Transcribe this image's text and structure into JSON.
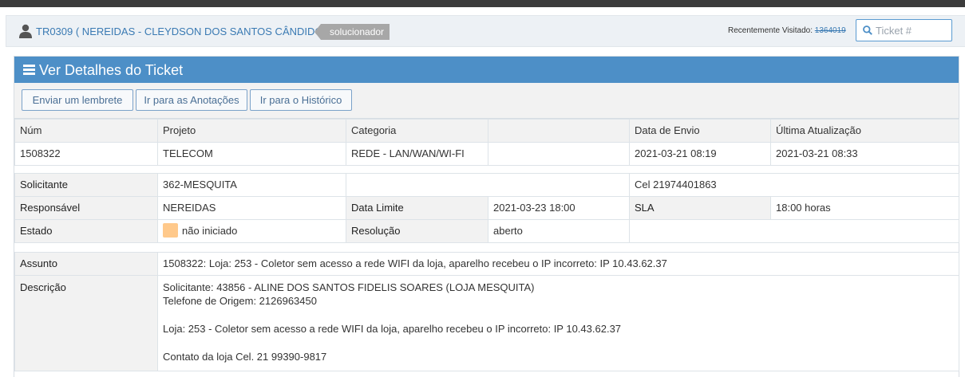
{
  "user": {
    "ticket_ref": "TR0309 ( NEREIDAS - CLEYDSON DOS SANTOS CÂNDIDO )",
    "role": "solucionador",
    "icon": "user-icon"
  },
  "recent": {
    "label": "Recentemente Visitado:",
    "ticket": "1364019"
  },
  "search": {
    "placeholder": "Ticket #",
    "icon": "search-icon"
  },
  "panel": {
    "title": "Ver Detalhes do Ticket",
    "icon": "menu-icon",
    "header_color": "#4d8fc7"
  },
  "toolbar": {
    "reminder": "Enviar um lembrete",
    "notes": "Ir para as Anotações",
    "history": "Ir para o Histórico"
  },
  "summary": {
    "headers": [
      "Núm",
      "Projeto",
      "Categoria",
      "",
      "Data de Envio",
      "Última Atualização"
    ],
    "values": [
      "1508322",
      "TELECOM",
      "REDE - LAN/WAN/WI-FI",
      "",
      "2021-03-21 08:19",
      "2021-03-21 08:33"
    ]
  },
  "details": {
    "solicitante_label": "Solicitante",
    "solicitante": "362-MESQUITA",
    "cel": "Cel 21974401863",
    "responsavel_label": "Responsável",
    "responsavel": "NEREIDAS",
    "data_limite_label": "Data Limite",
    "data_limite": "2021-03-23 18:00",
    "sla_label": "SLA",
    "sla": "18:00 horas",
    "estado_label": "Estado",
    "estado": "não iniciado",
    "estado_color": "#ffc98b",
    "resolucao_label": "Resolução",
    "resolucao": "aberto"
  },
  "content": {
    "assunto_label": "Assunto",
    "assunto": "1508322: Loja: 253 - Coletor sem acesso a rede WIFI da loja, aparelho recebeu o IP incorreto: IP 10.43.62.37",
    "descricao_label": "Descrição",
    "descricao": {
      "line1": "Solicitante: 43856 - ALINE DOS SANTOS FIDELIS SOARES (LOJA MESQUITA)",
      "line2": "Telefone de Origem: 2126963450",
      "line3": "Loja: 253 - Coletor sem acesso a rede WIFI da loja, aparelho recebeu o IP incorreto: IP 10.43.62.37",
      "line4": "Contato da loja Cel. 21 99390-9817"
    }
  }
}
